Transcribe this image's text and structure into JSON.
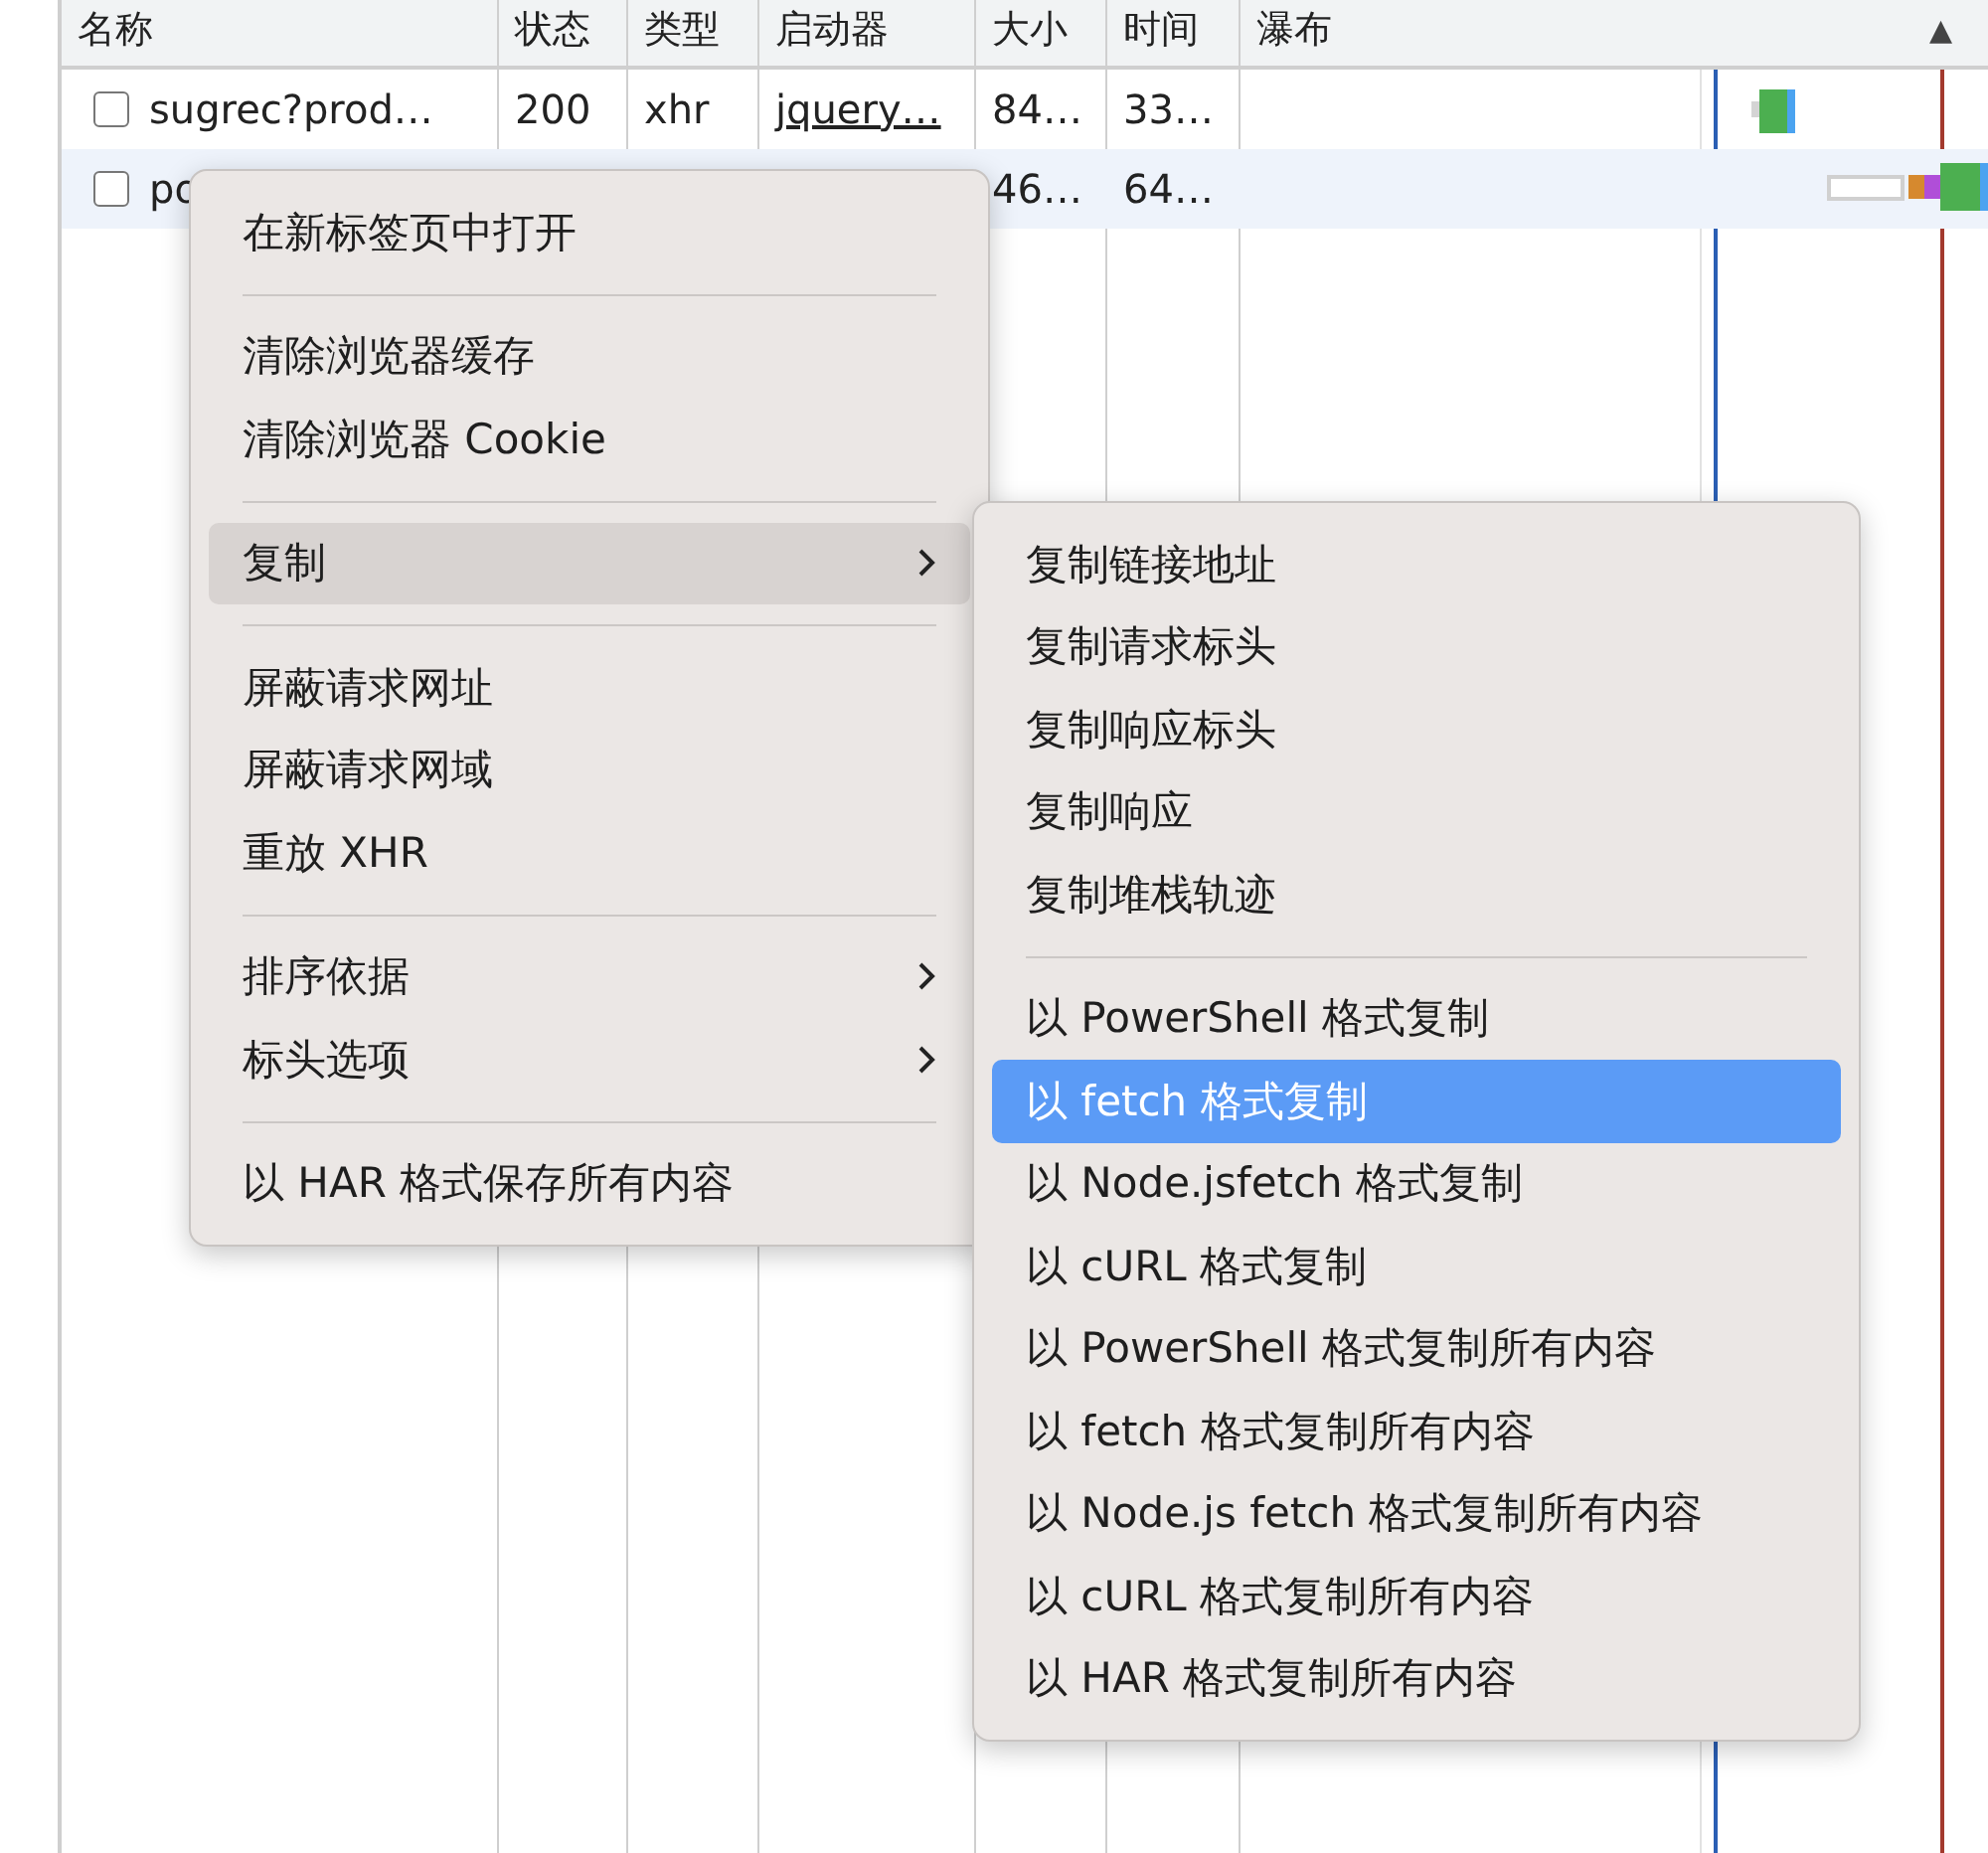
{
  "table": {
    "columns": [
      "名称",
      "状态",
      "类型",
      "启动器",
      "大小",
      "时间",
      "瀑布"
    ],
    "sort_indicator": "▲",
    "rows": [
      {
        "selected": false,
        "cells": [
          "sugrec?prod…",
          "200",
          "xhr",
          "jquery…",
          "84…",
          "33…"
        ]
      },
      {
        "selected": true,
        "cells": [
          "po",
          "",
          "",
          "",
          "46…",
          "64…"
        ]
      }
    ]
  },
  "context_menu": {
    "items": [
      {
        "kind": "item",
        "label": "在新标签页中打开",
        "submenu": false,
        "selected": false
      },
      {
        "kind": "separator"
      },
      {
        "kind": "item",
        "label": "清除浏览器缓存",
        "submenu": false,
        "selected": false
      },
      {
        "kind": "item",
        "label": "清除浏览器 Cookie",
        "submenu": false,
        "selected": false
      },
      {
        "kind": "separator"
      },
      {
        "kind": "item",
        "label": "复制",
        "submenu": true,
        "selected": true
      },
      {
        "kind": "separator"
      },
      {
        "kind": "item",
        "label": "屏蔽请求网址",
        "submenu": false,
        "selected": false
      },
      {
        "kind": "item",
        "label": "屏蔽请求网域",
        "submenu": false,
        "selected": false
      },
      {
        "kind": "item",
        "label": "重放 XHR",
        "submenu": false,
        "selected": false
      },
      {
        "kind": "separator"
      },
      {
        "kind": "item",
        "label": "排序依据",
        "submenu": true,
        "selected": false
      },
      {
        "kind": "item",
        "label": "标头选项",
        "submenu": true,
        "selected": false
      },
      {
        "kind": "separator"
      },
      {
        "kind": "item",
        "label": "以 HAR 格式保存所有内容",
        "submenu": false,
        "selected": false
      }
    ]
  },
  "submenu": {
    "items": [
      {
        "kind": "item",
        "label": "复制链接地址",
        "selected": false
      },
      {
        "kind": "item",
        "label": "复制请求标头",
        "selected": false
      },
      {
        "kind": "item",
        "label": "复制响应标头",
        "selected": false
      },
      {
        "kind": "item",
        "label": "复制响应",
        "selected": false
      },
      {
        "kind": "item",
        "label": "复制堆栈轨迹",
        "selected": false
      },
      {
        "kind": "separator"
      },
      {
        "kind": "item",
        "label": "以 PowerShell 格式复制",
        "selected": false
      },
      {
        "kind": "item",
        "label": "以 fetch 格式复制",
        "selected": true
      },
      {
        "kind": "item",
        "label": "以 Node.jsfetch 格式复制",
        "selected": false
      },
      {
        "kind": "item",
        "label": "以 cURL 格式复制",
        "selected": false
      },
      {
        "kind": "item",
        "label": "以 PowerShell 格式复制所有内容",
        "selected": false
      },
      {
        "kind": "item",
        "label": "以 fetch 格式复制所有内容",
        "selected": false
      },
      {
        "kind": "item",
        "label": "以 Node.js fetch 格式复制所有内容",
        "selected": false
      },
      {
        "kind": "item",
        "label": "以 cURL 格式复制所有内容",
        "selected": false
      },
      {
        "kind": "item",
        "label": "以 HAR 格式复制所有内容",
        "selected": false
      }
    ]
  }
}
